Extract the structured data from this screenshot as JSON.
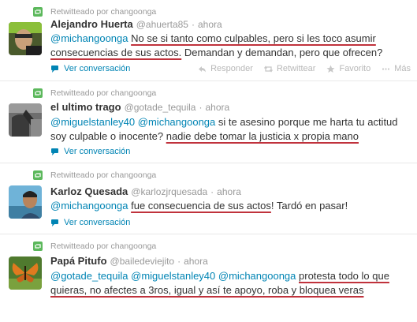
{
  "retweet_label": "Retwitteado por changoonga",
  "actions": {
    "view_conversation": "Ver conversación",
    "reply": "Responder",
    "retweet": "Retwittear",
    "favorite": "Favorito",
    "more": "Más"
  },
  "colors": {
    "link": "#0084b4",
    "muted": "#999999",
    "retweet_icon": "#5cb85c",
    "underline": "#c0323c"
  },
  "tweets": [
    {
      "name": "Alejandro Huerta",
      "handle": "@ahuerta85",
      "sep": "·",
      "time": "ahora",
      "text": {
        "m1": "@michangoonga",
        "t1": " ",
        "u1": "No se si tanto como culpables, pero si les toco asumir consecuencias de sus actos.",
        "t2": " Demandan y demandan, pero que ofrecen?"
      }
    },
    {
      "name": "el ultimo trago",
      "handle": "@gotade_tequila",
      "sep": "·",
      "time": "ahora",
      "text": {
        "m1": "@miguelstanley40",
        "t1": " ",
        "m2": "@michangoonga",
        "t2": " si te asesino porque me harta tu actitud soy culpable o inocente? ",
        "u1": "nadie debe tomar la justicia x propia mano"
      }
    },
    {
      "name": "Karloz Quesada",
      "handle": "@karlozjrquesada",
      "sep": "·",
      "time": "ahora",
      "text": {
        "m1": "@michangoonga",
        "t1": " ",
        "u1": "fue consecuencia de sus actos",
        "t2": "! Tardó en pasar!"
      }
    },
    {
      "name": "Papá Pitufo",
      "handle": "@bailedeviejito",
      "sep": "·",
      "time": "ahora",
      "text": {
        "m1": "@gotade_tequila",
        "t1": " ",
        "m2": "@miguelstanley40",
        "t2": " ",
        "m3": "@michangoonga",
        "t3": " ",
        "u1": "protesta todo lo que quieras, no afectes a 3ros, igual y así te apoyo, roba y bloquea veras"
      }
    }
  ]
}
